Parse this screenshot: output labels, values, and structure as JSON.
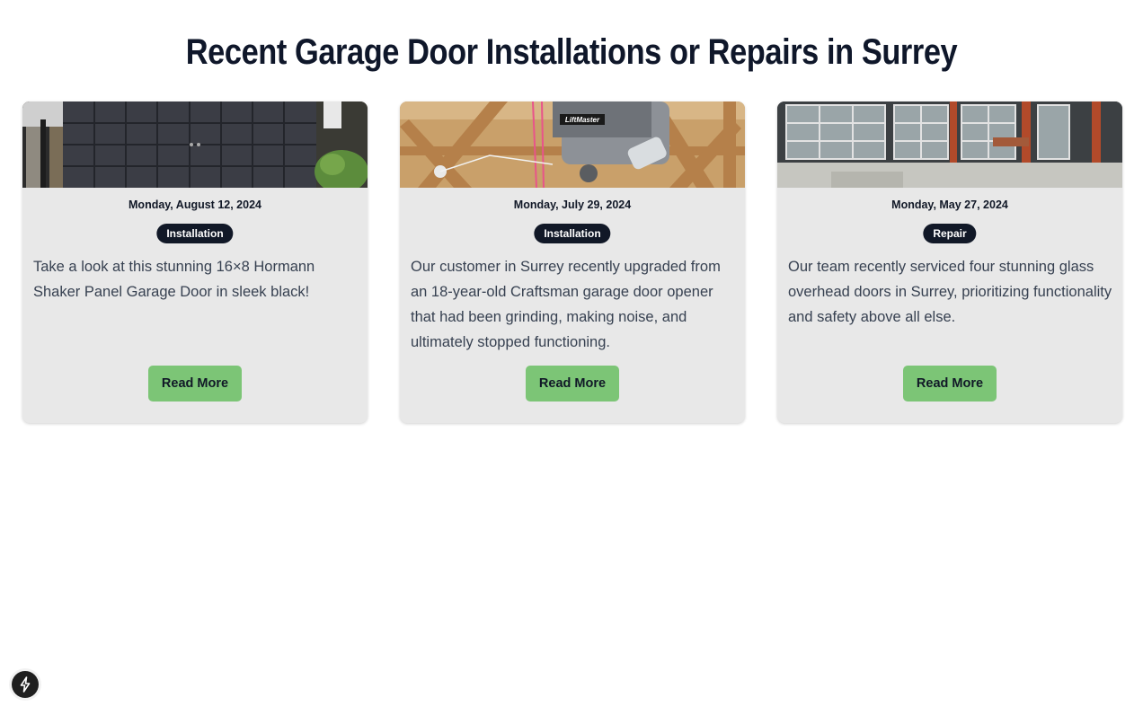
{
  "heading": "Recent Garage Door Installations or Repairs in Surrey",
  "cards": [
    {
      "image_alt": "black shaker panel garage door",
      "date": "Monday, August 12, 2024",
      "category": "Installation",
      "excerpt": "Take a look at this stunning 16×8 Hormann Shaker Panel Garage Door in sleek black!",
      "button": "Read More"
    },
    {
      "image_alt": "LiftMaster garage door opener mounted on wooden joists",
      "date": "Monday, July 29, 2024",
      "category": "Installation",
      "excerpt": "Our customer in Surrey recently upgraded from an 18-year-old Craftsman garage door opener that had been grinding, making noise, and ultimately stopped functioning.",
      "button": "Read More"
    },
    {
      "image_alt": "glass overhead doors",
      "date": "Monday, May 27, 2024",
      "category": "Repair",
      "excerpt": "Our team recently serviced four stunning glass overhead doors in Surrey, prioritizing functionality and safety above all else.",
      "button": "Read More"
    }
  ],
  "image_labels": {
    "opener_brand": "LiftMaster"
  },
  "colors": {
    "button": "#7cc576",
    "badge": "#111827",
    "card": "#e8e8e8"
  },
  "corner_icon": "lightning-bolt-icon"
}
